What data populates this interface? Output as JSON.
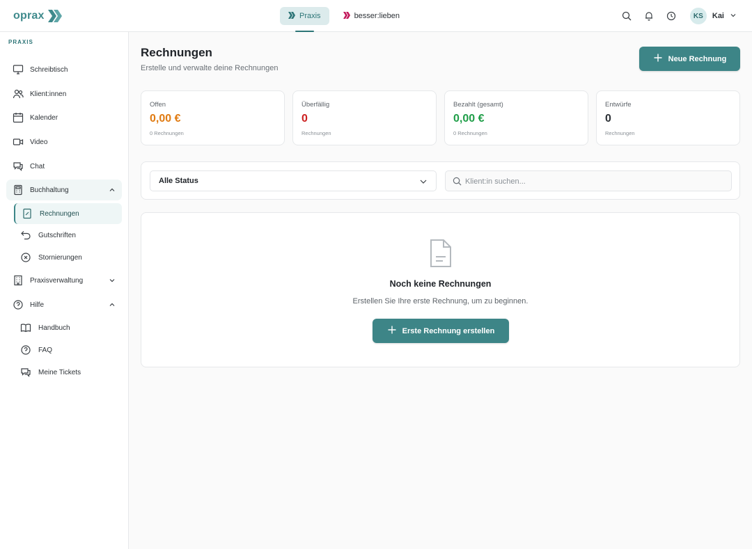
{
  "brand": {
    "name": "oprax",
    "color": "#3f8a8c"
  },
  "switcher": [
    {
      "label": "Praxis",
      "icon": "praxis-chevrons-icon",
      "active": true
    },
    {
      "label": "besser:lieben",
      "icon": "besserlieben-chevrons-icon",
      "active": false
    }
  ],
  "header": {
    "icons": [
      "search-icon",
      "bell-icon",
      "clock-icon"
    ],
    "user": {
      "initials": "KS",
      "name": "Kai"
    }
  },
  "sidebar": {
    "section": "PRAXIS",
    "items": [
      {
        "label": "Schreibtisch",
        "icon": "monitor-icon"
      },
      {
        "label": "Klient:innen",
        "icon": "users-icon"
      },
      {
        "label": "Kalender",
        "icon": "calendar-icon"
      },
      {
        "label": "Video",
        "icon": "video-icon"
      },
      {
        "label": "Chat",
        "icon": "chat-icon"
      },
      {
        "label": "Buchhaltung",
        "icon": "calculator-icon",
        "expanded": true
      },
      {
        "label": "Praxisverwaltung",
        "icon": "building-icon",
        "expanded": false
      },
      {
        "label": "Hilfe",
        "icon": "help-circle-icon",
        "expanded": true
      }
    ],
    "buchhaltung_sub": [
      {
        "label": "Rechnungen",
        "icon": "invoice-icon",
        "active": true
      },
      {
        "label": "Gutschriften",
        "icon": "undo-icon"
      },
      {
        "label": "Stornierungen",
        "icon": "cancel-circle-icon"
      }
    ],
    "hilfe_sub": [
      {
        "label": "Handbuch",
        "icon": "book-icon"
      },
      {
        "label": "FAQ",
        "icon": "question-icon"
      },
      {
        "label": "Meine Tickets",
        "icon": "tickets-icon"
      }
    ]
  },
  "main": {
    "title": "Rechnungen",
    "subtitle": "Erstelle und verwalte deine Rechnungen",
    "new_button": "Neue Rechnung",
    "stats": [
      {
        "label": "Offen",
        "value": "0,00 €",
        "sub": "0 Rechnungen",
        "color": "#e07b12"
      },
      {
        "label": "Überfällig",
        "value": "0",
        "sub": "Rechnungen",
        "color": "#cc1f1f"
      },
      {
        "label": "Bezahlt (gesamt)",
        "value": "0,00 €",
        "sub": "0 Rechnungen",
        "color": "#1f9e48"
      },
      {
        "label": "Entwürfe",
        "value": "0",
        "sub": "Rechnungen",
        "color": "#2c3136"
      }
    ],
    "filter": {
      "status_value": "Alle Status",
      "search_placeholder": "Klient:in suchen..."
    },
    "empty": {
      "title": "Noch keine Rechnungen",
      "description": "Erstellen Sie Ihre erste Rechnung, um zu beginnen.",
      "button": "Erste Rechnung erstellen"
    }
  },
  "colors": {
    "accent": "#3d8587",
    "accent_light": "#dcebec",
    "besserlieben": "#c2185b"
  }
}
